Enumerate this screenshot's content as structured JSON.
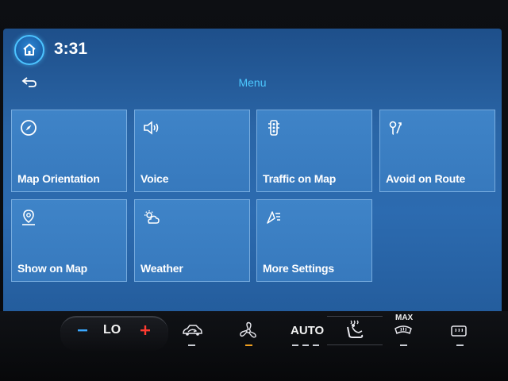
{
  "status_bar": {
    "time": "3:31"
  },
  "header": {
    "title": "Menu"
  },
  "tiles": [
    {
      "label": "Map Orientation",
      "icon": "compass-icon"
    },
    {
      "label": "Voice",
      "icon": "speaker-icon"
    },
    {
      "label": "Traffic on Map",
      "icon": "traffic-light-icon"
    },
    {
      "label": "Avoid on Route",
      "icon": "avoid-route-icon"
    },
    {
      "label": "Show on Map",
      "icon": "map-pin-icon"
    },
    {
      "label": "Weather",
      "icon": "weather-icon"
    },
    {
      "label": "More Settings",
      "icon": "more-settings-icon"
    }
  ],
  "climate": {
    "temperature": "LO",
    "auto_label": "AUTO",
    "max_defrost_label": "MAX"
  },
  "colors": {
    "accent": "#4cc8ff",
    "tile": "#3b7fc3",
    "minus": "#3aa8ff",
    "plus": "#ff3b30",
    "fan_indicator": "#f0a020"
  }
}
